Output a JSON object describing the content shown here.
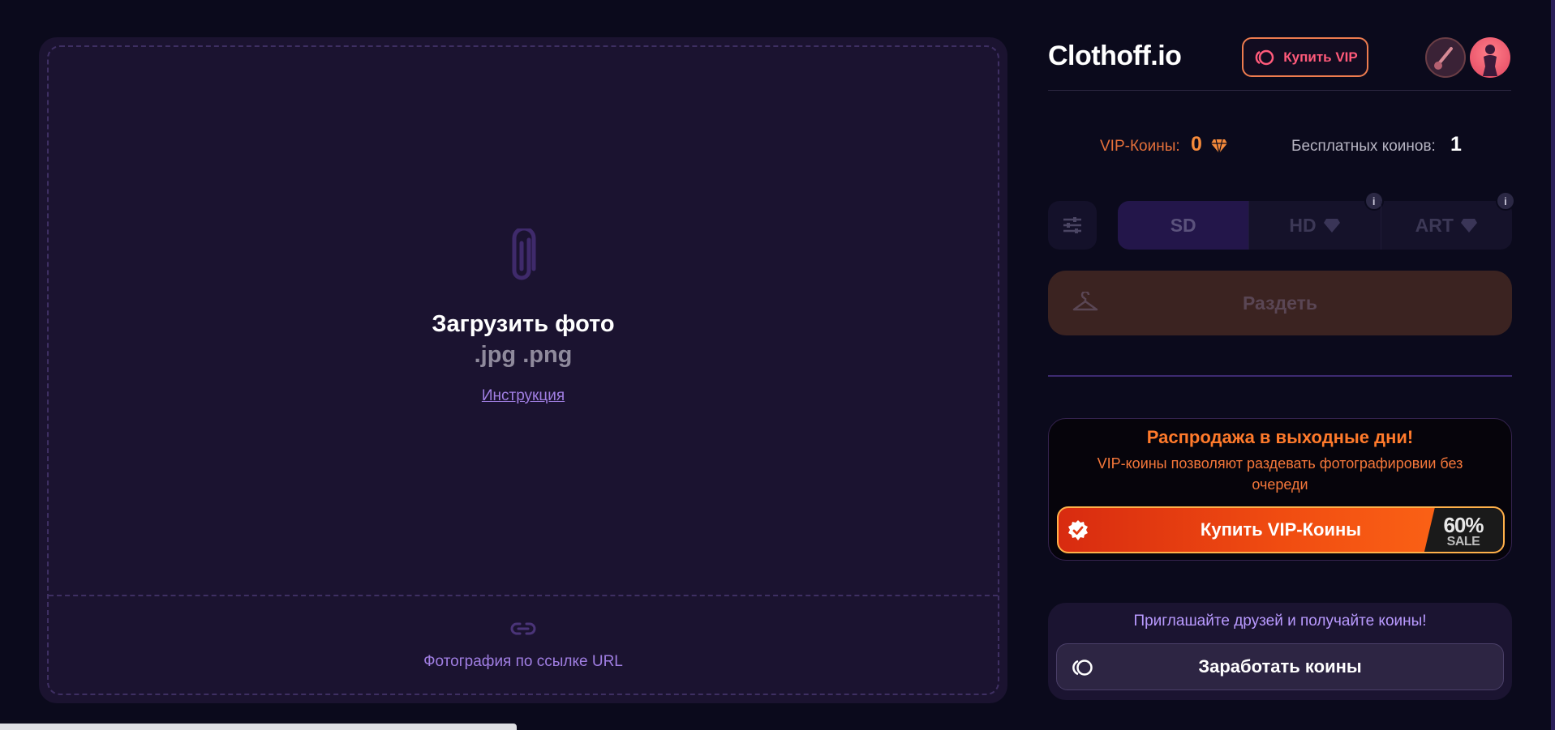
{
  "upload": {
    "title": "Загрузить фото",
    "formats": ".jpg .png",
    "instruction_link": "Инструкция",
    "url_label": "Фотография по ссылке URL",
    "icons": [
      "paperclip-icon",
      "link-icon"
    ]
  },
  "header": {
    "brand": "Clothoff.io",
    "buy_vip_label": "Купить VIP",
    "avatars": [
      "brush-avatar",
      "user-avatar"
    ]
  },
  "balance": {
    "vip_coins_label": "VIP-Коины:",
    "vip_coins_value": "0",
    "free_coins_label": "Бесплатных коинов:",
    "free_coins_value": "1"
  },
  "quality": {
    "tabs": [
      {
        "label": "SD",
        "active": true
      },
      {
        "label": "HD",
        "active": false
      },
      {
        "label": "ART",
        "active": false
      }
    ]
  },
  "actions": {
    "undress_label": "Раздеть"
  },
  "promo": {
    "title": "Распродажа в выходные дни!",
    "description": "VIP-коины позволяют раздевать фотографировии без очереди",
    "buy_label": "Купить VIP-Коины",
    "sale_percent": "60%",
    "sale_word": "SALE"
  },
  "invite": {
    "text": "Приглашайте друзей и получайте коины!",
    "earn_label": "Заработать коины"
  },
  "colors": {
    "background": "#0b0a1c",
    "card": "#1b1330",
    "accent_orange": "#f58a3b",
    "accent_purple": "#a07ee2"
  }
}
